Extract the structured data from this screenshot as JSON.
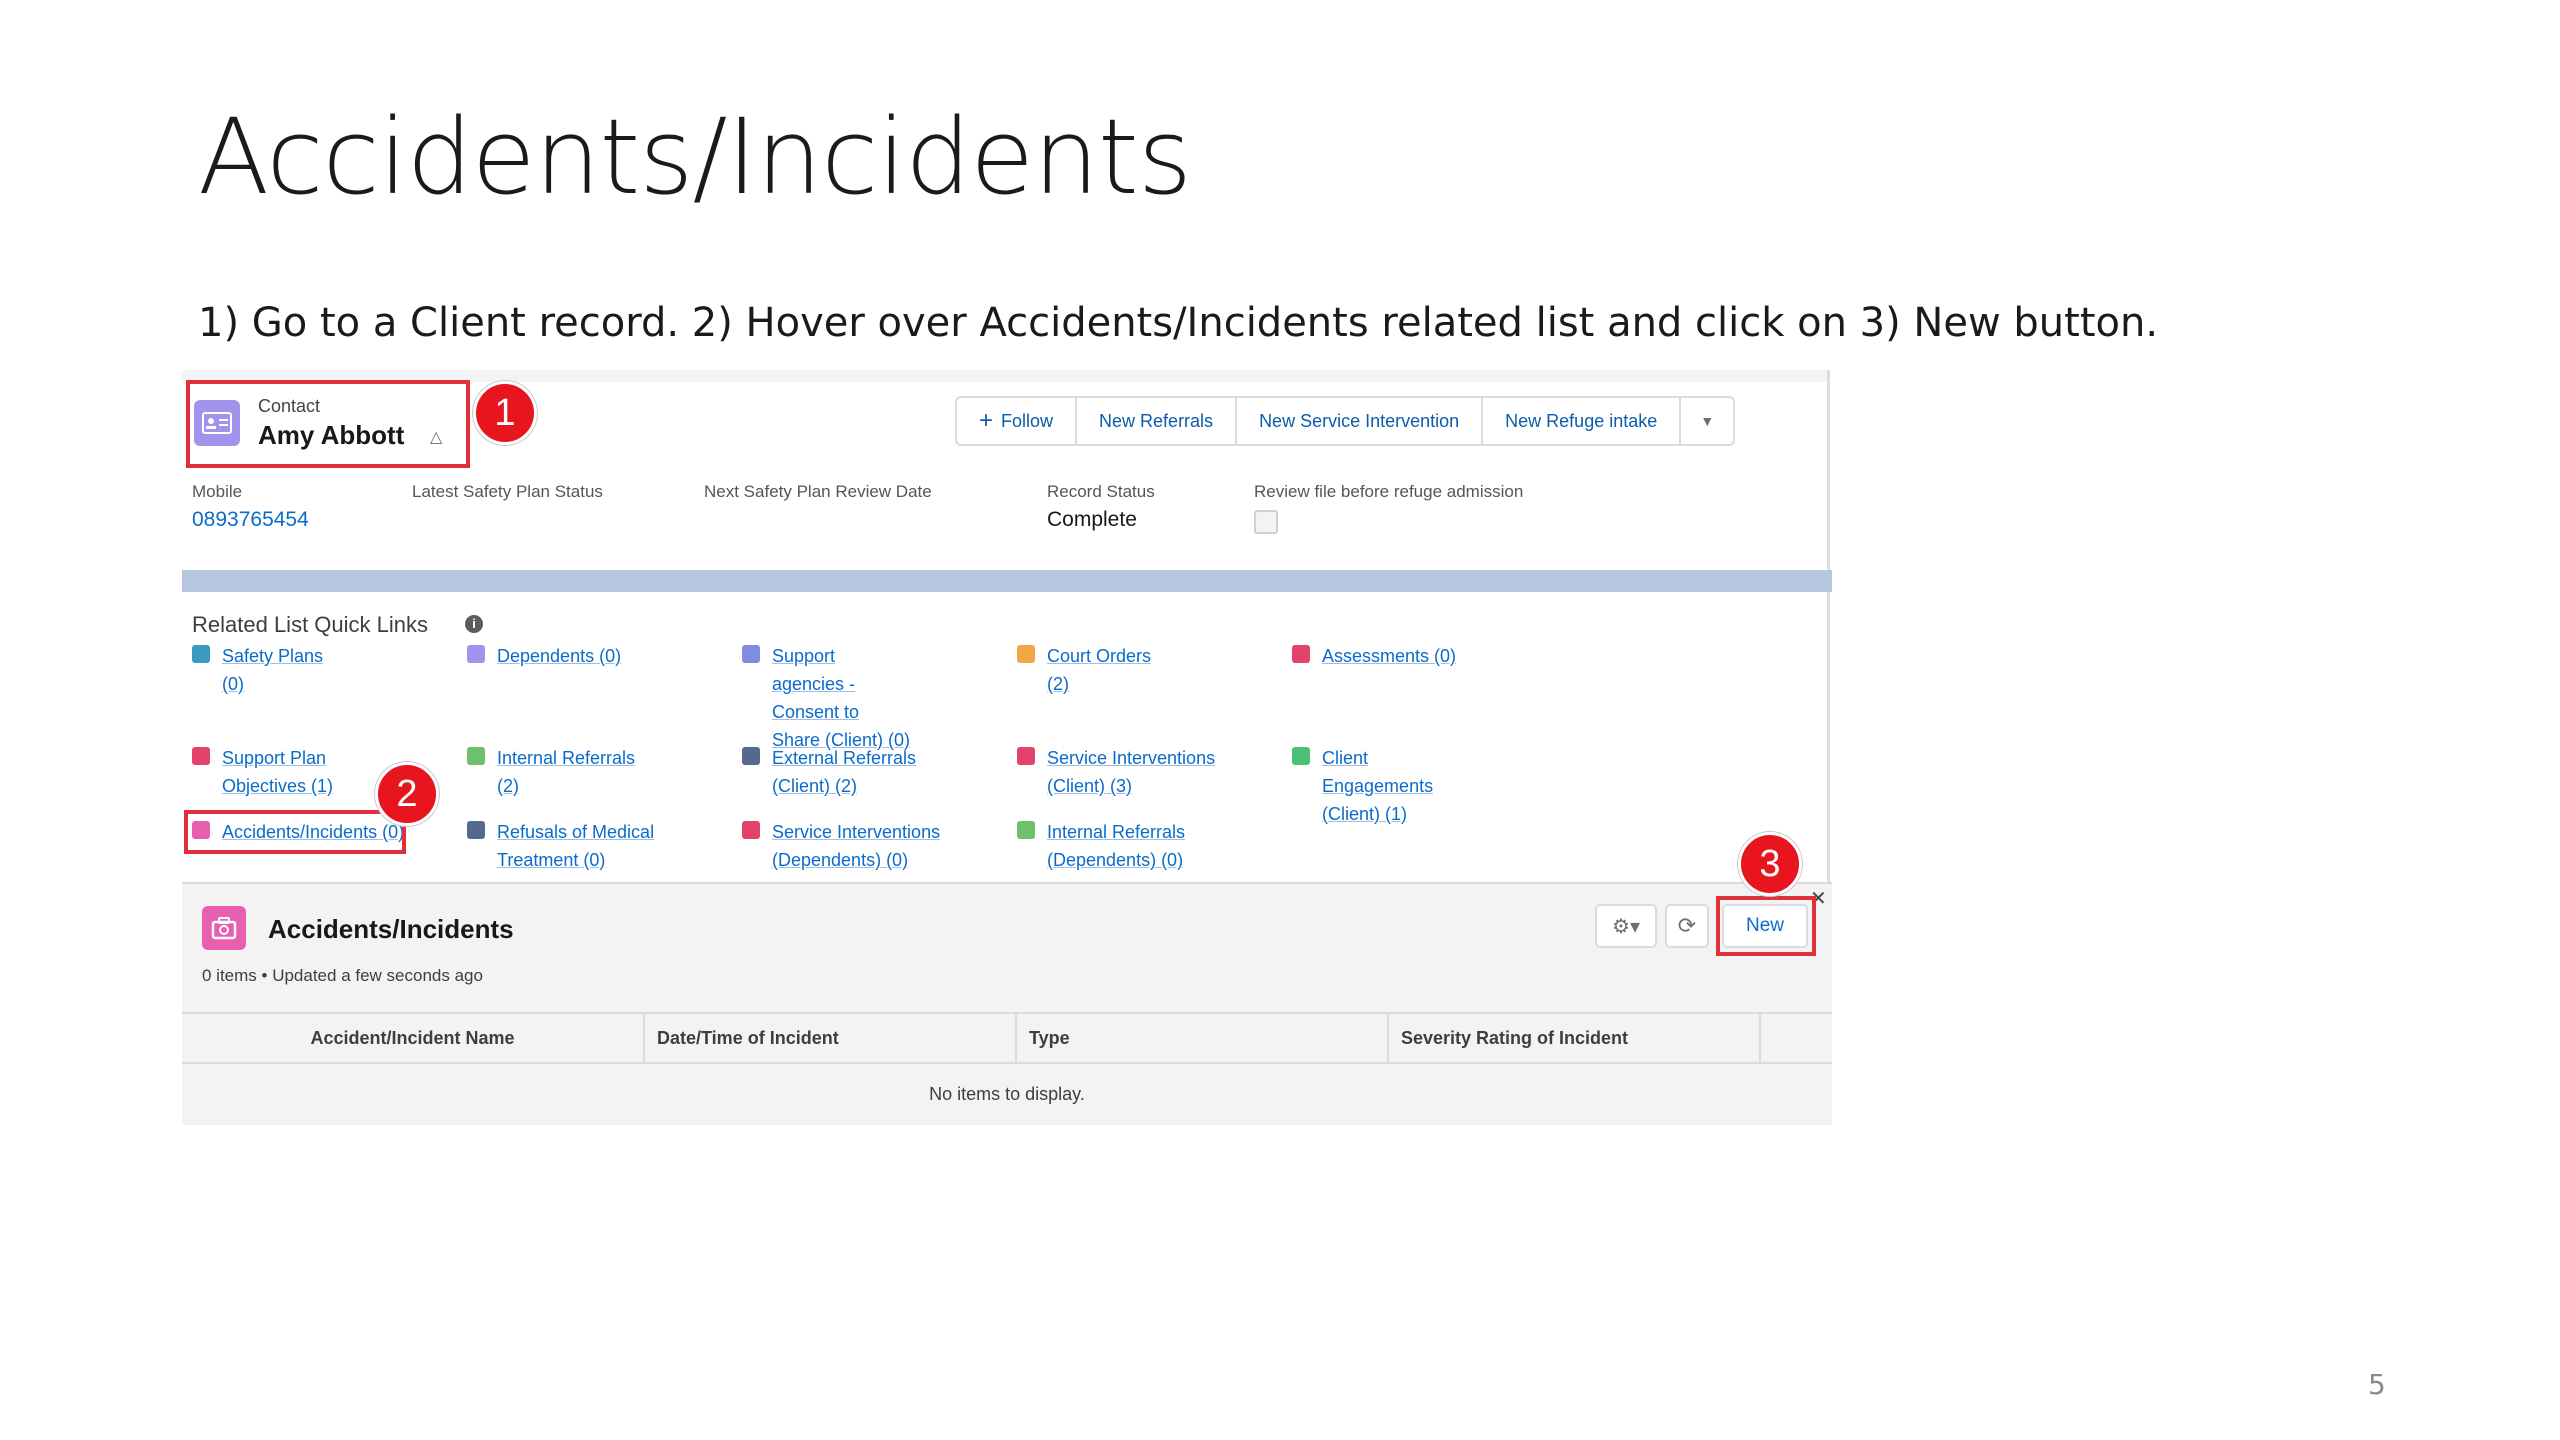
{
  "slide": {
    "title": "Accidents/Incidents",
    "instruction": "1)   Go to a Client record. 2) Hover over Accidents/Incidents related list and click on 3) New button.",
    "page_number": "5"
  },
  "callouts": [
    "1",
    "2",
    "3"
  ],
  "record": {
    "object_label": "Contact",
    "name": "Amy Abbott",
    "actions": [
      "Follow",
      "New Referrals",
      "New Service Intervention",
      "New Refuge intake"
    ],
    "fields": [
      {
        "label": "Mobile",
        "value": "0893765454"
      },
      {
        "label": "Latest Safety Plan Status",
        "value": ""
      },
      {
        "label": "Next Safety Plan Review Date",
        "value": ""
      },
      {
        "label": "Record Status",
        "value": "Complete"
      },
      {
        "label": "Review file before refuge admission",
        "value": ""
      }
    ]
  },
  "quick_links": {
    "title": "Related List Quick Links",
    "items": [
      {
        "label": "Safety Plans (0)",
        "color": "#3a9bc0"
      },
      {
        "label": "Dependents (0)",
        "color": "#a094ed"
      },
      {
        "label": "Support agencies - Consent to Share (Client) (0)",
        "color": "#7f8de1"
      },
      {
        "label": "Court Orders (2)",
        "color": "#f4a548"
      },
      {
        "label": "Assessments (0)",
        "color": "#e3436b"
      },
      {
        "label": "Support Plan Objectives (1)",
        "color": "#e3436b"
      },
      {
        "label": "Internal Referrals (2)",
        "color": "#6fc06d"
      },
      {
        "label": "External Referrals (Client) (2)",
        "color": "#54698d"
      },
      {
        "label": "Service Interventions (Client) (3)",
        "color": "#e3436b"
      },
      {
        "label": "Client Engagements (Client) (1)",
        "color": "#4bc076"
      },
      {
        "label": "Accidents/Incidents (0)",
        "color": "#e95fb0"
      },
      {
        "label": "Refusals of Medical Treatment (0)",
        "color": "#54698d"
      },
      {
        "label": "Service Interventions (Dependents) (0)",
        "color": "#e3436b"
      },
      {
        "label": "Internal Referrals (Dependents) (0)",
        "color": "#6fc06d"
      }
    ]
  },
  "related_list": {
    "title": "Accidents/Incidents",
    "subtitle": "0 items • Updated a few seconds ago",
    "new_label": "New",
    "columns": [
      "Accident/Incident Name",
      "Date/Time of Incident",
      "Type",
      "Severity Rating of Incident"
    ],
    "empty_message": "No items to display."
  },
  "colors": {
    "highlight": "#e0303a",
    "callout": "#e8141e",
    "link": "#0b6bcb"
  }
}
